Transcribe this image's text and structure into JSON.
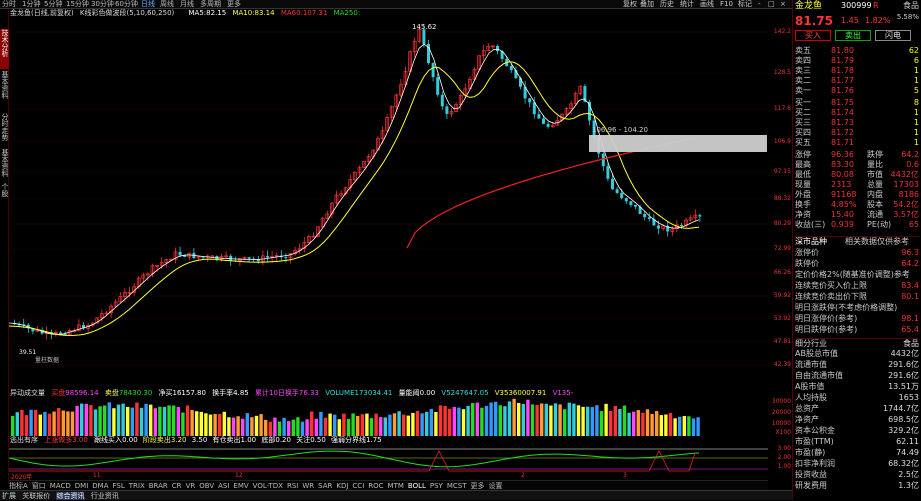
{
  "topbar": {
    "tabs": [
      "分时",
      "1分钟",
      "5分钟",
      "15分钟",
      "30分钟",
      "60分钟",
      "日线",
      "周线",
      "月线",
      "多周期",
      "更多"
    ],
    "active_tab": "日线",
    "buttons": [
      "复权",
      "叠加",
      "历史",
      "统计",
      "画线",
      "F10",
      "标记",
      "-",
      "□",
      "×"
    ]
  },
  "leftstrip": [
    "技术分析",
    "基本资料",
    "分时走势",
    "基本资料",
    "个股"
  ],
  "chart_header": {
    "name": "金龙鱼(日线,前复权)",
    "indicator": "K线彩色做波段(5,10,60,250)",
    "ma5_label": "MA5:",
    "ma5": "82.15",
    "ma10_label": "MA10:",
    "ma10": "83.14",
    "ma60_label": "MA60:",
    "ma60": "107.31",
    "ma250_label": "MA250:",
    "ma250": ""
  },
  "price_axis": [
    "142.2",
    "128.5",
    "117.6",
    "106.9",
    "97.15",
    "88.32",
    "80.29",
    "72.99",
    "66.26",
    "59.92",
    "53.92",
    "47.81",
    "42.39"
  ],
  "annotations": {
    "high": "145.62",
    "low": "39.51",
    "box_label": "106.96 - 104.20",
    "bottom_label": "量柱数据"
  },
  "volume_header": {
    "title": "异动成交量",
    "t1": "买盘",
    "v1": "98596.14",
    "t2": "卖盘",
    "v2": "78430.30",
    "t3": "净买",
    "v3": "16157.80",
    "t4": "换手率",
    "v4": "4.85",
    "t5": "累计10日换手",
    "v5": "76.33",
    "t6": "VOLUME",
    "v6": "173034.41",
    "t7": "量能阈",
    "v7": "0.00",
    "t8": "V5",
    "v8": "247647.05",
    "t9": "V35",
    "v9": "360007.91",
    "t10": "V135",
    "v10": "-"
  },
  "volume_axis": [
    "30000",
    "20000",
    "10000",
    "X100"
  ],
  "indicator_header": {
    "title": "逃出有序",
    "a": "上涨做多",
    "av": "3.00",
    "b": "跟线买入",
    "bv": "0.00",
    "c": "阶段卖出",
    "cv": "3.20",
    "d": "3.50",
    "e": "有仓卖出",
    "ev": "1.00",
    "f": "底部",
    "fv": "0.20",
    "g": "关注",
    "gv": "0.50",
    "h": "强弱分界线",
    "hv": "1.75"
  },
  "indicator_axis": [
    "3.00",
    "2.00",
    "1.00"
  ],
  "date_axis": [
    "2020年",
    "11",
    "12",
    "2",
    "3"
  ],
  "indicator_tabs": [
    "指标A",
    "窗口",
    "MACD",
    "DMI",
    "DMA",
    "FSL",
    "TRIX",
    "BRAR",
    "CR",
    "VR",
    "OBV",
    "ASI",
    "EMV",
    "VOL-TDX",
    "RSI",
    "WR",
    "SAR",
    "KDJ",
    "CCI",
    "ROC",
    "MTM",
    "BOLL",
    "PSY",
    "MCST",
    "更多",
    "设置"
  ],
  "bottombar": [
    "扩展",
    "关联报价",
    "综合资讯",
    "行业资讯"
  ],
  "quote": {
    "name": "金龙鱼",
    "code": "300999",
    "flag": "R",
    "right_label": "食品",
    "right_sub": "5.58%",
    "price": "81.75",
    "change": "1.45",
    "pct": "1.82%",
    "buttons": [
      "买入",
      "卖出",
      "闪电"
    ],
    "asks": [
      {
        "label": "卖五",
        "price": "81.80",
        "vol": "62"
      },
      {
        "label": "卖四",
        "price": "81.79",
        "vol": "6"
      },
      {
        "label": "卖三",
        "price": "81.78",
        "vol": "1"
      },
      {
        "label": "卖二",
        "price": "81.77",
        "vol": "1"
      },
      {
        "label": "卖一",
        "price": "81.76",
        "vol": "5"
      }
    ],
    "bids": [
      {
        "label": "买一",
        "price": "81.75",
        "vol": "8"
      },
      {
        "label": "买二",
        "price": "81.74",
        "vol": "1"
      },
      {
        "label": "买三",
        "price": "81.73",
        "vol": "1"
      },
      {
        "label": "买四",
        "price": "81.72",
        "vol": "1"
      },
      {
        "label": "买五",
        "price": "81.71",
        "vol": "1"
      }
    ],
    "stats": [
      {
        "k1": "涨停",
        "v1": "96.36",
        "k2": "跌停",
        "v2": "64.2"
      },
      {
        "k1": "最高",
        "v1": "83.30",
        "k2": "量比",
        "v2": "0.6"
      },
      {
        "k1": "最低",
        "v1": "80.08",
        "k2": "市值",
        "v2": "4432亿"
      },
      {
        "k1": "现量",
        "v1": "2313",
        "k2": "总量",
        "v2": "17303"
      },
      {
        "k1": "外盘",
        "v1": "91168",
        "k2": "内盘",
        "v2": "8186"
      },
      {
        "k1": "换手",
        "v1": "4.85%",
        "k2": "股本",
        "v2": "54.2亿"
      },
      {
        "k1": "净资",
        "v1": "15.40",
        "k2": "流通",
        "v2": "3.57亿"
      },
      {
        "k1": "收益(三)",
        "v1": "0.939",
        "k2": "PE(动)",
        "v2": "65"
      }
    ],
    "section_title": "深市品种",
    "section_title2": "相关数据仅供参考",
    "rows": [
      {
        "k": "涨停价",
        "v": "96.3"
      },
      {
        "k": "跌停价",
        "v": "64.2"
      },
      {
        "k": "定价价格2%(随基准价调整)参考",
        "v": ""
      },
      {
        "k": "连续竞价买入价上限",
        "v": "83.4"
      },
      {
        "k": "连续竞价卖出价下限",
        "v": "80.1"
      },
      {
        "k": "明日涨跌停(不考虑价格调整)",
        "v": ""
      },
      {
        "k": "明日涨停价(参考)",
        "v": "98.1"
      },
      {
        "k": "明日跌停价(参考)",
        "v": "65.4"
      }
    ],
    "industry_label": "细分行业",
    "industry": "食品",
    "fin": [
      {
        "k": "AB股总市值",
        "v": "4432亿"
      },
      {
        "k": "流通市值",
        "v": "291.6亿"
      },
      {
        "k": "自由流通市值",
        "v": "291.6亿"
      },
      {
        "k": "A股市值",
        "v": "13.51万"
      },
      {
        "k": "人均持股",
        "v": "1653"
      },
      {
        "k": "总资产",
        "v": "1744.7亿"
      },
      {
        "k": "净资产",
        "v": "698.5亿"
      },
      {
        "k": "资本公积金",
        "v": "329.2亿"
      },
      {
        "k": "市盈(TTM)",
        "v": "62.11"
      },
      {
        "k": "市盈(静)",
        "v": "74.49"
      },
      {
        "k": "扣非净利润",
        "v": "68.32亿"
      },
      {
        "k": "投资收益",
        "v": "2.5亿"
      },
      {
        "k": "研发费用",
        "v": "1.3亿"
      }
    ]
  }
}
